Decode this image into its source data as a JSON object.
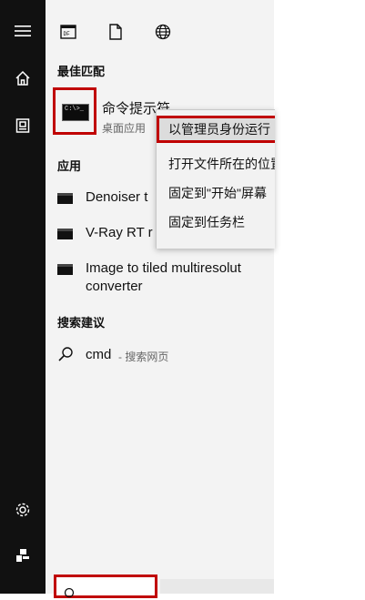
{
  "rail": {
    "items": [
      {
        "icon": "hamburger-menu-icon"
      },
      {
        "icon": "home-icon"
      },
      {
        "icon": "documents-icon"
      },
      {
        "icon": "settings-icon"
      },
      {
        "icon": "user-icon"
      }
    ]
  },
  "tabs": [
    {
      "icon": "apps-icon"
    },
    {
      "icon": "document-icon"
    },
    {
      "icon": "web-globe-icon"
    }
  ],
  "sections": {
    "best_match": "最佳匹配",
    "apps": "应用",
    "search_suggestions": "搜索建议"
  },
  "best_match": {
    "title": "命令提示符",
    "subtitle": "桌面应用"
  },
  "apps": [
    {
      "label": "Denoiser t"
    },
    {
      "label": "V-Ray RT r"
    },
    {
      "label": "Image to tiled multiresolut",
      "label2": "converter"
    }
  ],
  "search_suggestion": {
    "query": "cmd",
    "hint": "- 搜索网页"
  },
  "context_menu": {
    "items": [
      {
        "label": "以管理员身份运行"
      },
      {
        "label": "打开文件所在的位置"
      },
      {
        "label": "固定到\"开始\"屏幕"
      },
      {
        "label": "固定到任务栏"
      }
    ]
  },
  "colors": {
    "rail_bg": "#111111",
    "panel_bg": "#f3f3f3",
    "highlight_border": "#c00000"
  }
}
